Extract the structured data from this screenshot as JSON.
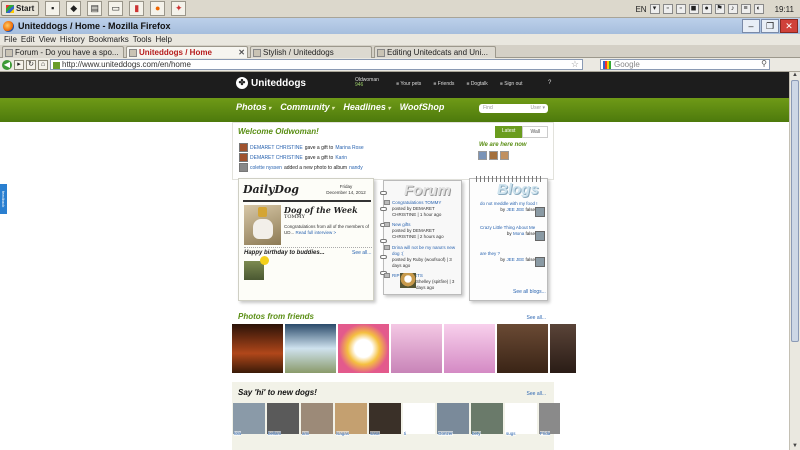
{
  "taskbar": {
    "start": "Start",
    "lang": "EN",
    "time": "19:11"
  },
  "window": {
    "title": "Uniteddogs / Home - Mozilla Firefox"
  },
  "menu": [
    "File",
    "Edit",
    "View",
    "History",
    "Bookmarks",
    "Tools",
    "Help"
  ],
  "tabs": [
    {
      "label": "Forum - Do you have a spo..."
    },
    {
      "label": "Uniteddogs / Home"
    },
    {
      "label": "Stylish / Uniteddogs"
    },
    {
      "label": "Editing Unitedcats and Uni..."
    }
  ],
  "url": "http://www.uniteddogs.com/en/home",
  "search_placeholder": "Google",
  "site": {
    "brand": "Uniteddogs",
    "user_name": "Oldwoman",
    "user_points": "946",
    "header_links": [
      "Your pets",
      "Friends",
      "Dogtalk",
      "Sign out"
    ],
    "nav": [
      "Photos",
      "Community",
      "Headlines",
      "WoofShop"
    ],
    "find_placeholder": "Find",
    "find_filter": "User",
    "feedback": "feedback",
    "welcome": {
      "title": "Welcome Oldwoman!",
      "tab_latest": "Latest",
      "tab_wall": "Wall",
      "we_are_here": "We are here now",
      "activity": [
        {
          "name": "DEMARET CHRISTINE",
          "action": "gave a gift to",
          "target": "Marina Rose"
        },
        {
          "name": "DEMARET CHRISTINE",
          "action": "gave a gift to",
          "target": "Karin"
        },
        {
          "name": "colette nyssen",
          "action": "added a new photo to album",
          "target": "nandy"
        }
      ]
    },
    "daily_dog": {
      "title": "DailyDog",
      "day": "Friday",
      "date": "December 14, 2012",
      "dotw": "Dog of the Week",
      "dog_name": "TOMMY",
      "congrats": "Congratulations from all of the members of UD...",
      "interview_link": "Read full interview >",
      "birthday": "Happy birthday to buddies...",
      "see_all": "See all..."
    },
    "forum": {
      "title": "Forum",
      "posts": [
        {
          "title": "Congratulations TOMMY",
          "by": "posted by DEMARET CHRISTINE | 1 hour ago"
        },
        {
          "title": "New gifts",
          "by": "posted by DEMARET CHRISTINE | 2 hours ago"
        },
        {
          "title": "Drina will not be my nana's new dog :(",
          "by": "posted by Ruby (woofsoof) | 3 days ago"
        },
        {
          "title": "RIP NUGGETS",
          "by": "Shelley (spitfire) | 3 days ago"
        }
      ]
    },
    "blogs": {
      "title": "Blogs",
      "posts": [
        {
          "title": "do not meddle with my food !",
          "by_prefix": "by",
          "author": "JEE JEE",
          "extra": "false"
        },
        {
          "title": "Crazy Little Thing About Me",
          "by_prefix": "by",
          "author": "Mona",
          "extra": "false"
        },
        {
          "title": "are they ?",
          "by_prefix": "by",
          "author": "JEE JEE",
          "extra": "false"
        }
      ],
      "see_all": "See all blogs..."
    },
    "photos": {
      "title": "Photos from friends",
      "see_all": "See all..."
    },
    "say_hi": {
      "title": "Say 'hi' to new dogs!",
      "see_all": "See all...",
      "dogs": [
        "lola",
        "bellani",
        "ami",
        "lsagas",
        "sasa",
        "ti",
        "Gonzer",
        "bety",
        "sugs",
        "Frida"
      ]
    }
  }
}
